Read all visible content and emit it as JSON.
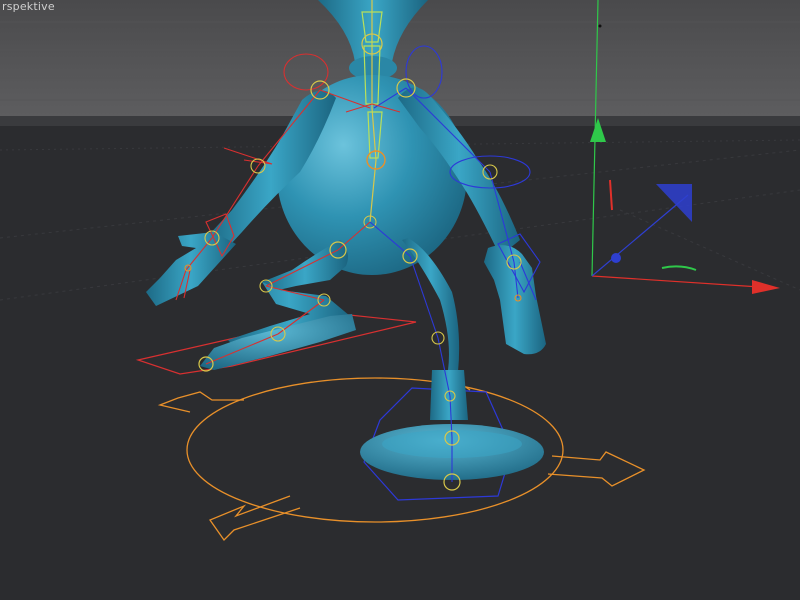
{
  "viewport": {
    "label": "rspektive",
    "colors": {
      "sky_top": "#4a4a4c",
      "sky_bottom": "#5a5a5c",
      "floor": "#2b2c2f",
      "mesh": "#2f93b3",
      "mesh_shadow": "#1d6a86",
      "mesh_highlight": "#7fd0e6",
      "axis_x": "#e0302a",
      "axis_y": "#2fc84a",
      "axis_z": "#2e3fd0",
      "root_control": "#e8902a",
      "joint_yellow": "#d8c84a",
      "ik_red": "#d83030",
      "ik_blue": "#2d39d8"
    }
  }
}
